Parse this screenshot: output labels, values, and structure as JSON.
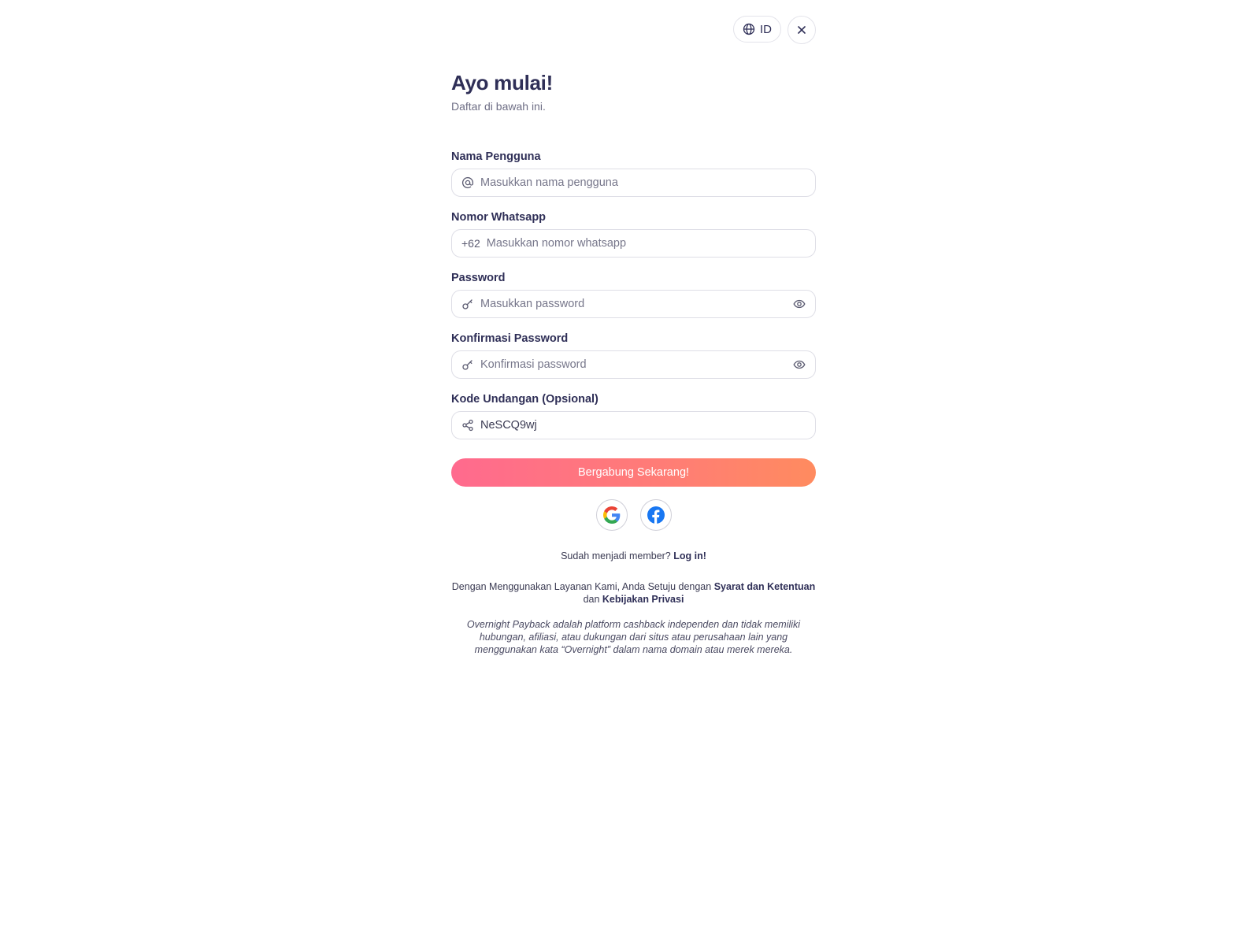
{
  "header": {
    "language_label": "ID",
    "language_icon": "globe-icon",
    "close_icon": "close-icon"
  },
  "intro": {
    "title": "Ayo mulai!",
    "subtitle": "Daftar di bawah ini."
  },
  "form": {
    "username": {
      "label": "Nama Pengguna",
      "placeholder": "Masukkan nama pengguna",
      "value": "",
      "icon": "at-icon"
    },
    "whatsapp": {
      "label": "Nomor Whatsapp",
      "prefix": "+62",
      "placeholder": "Masukkan nomor whatsapp",
      "value": ""
    },
    "password": {
      "label": "Password",
      "placeholder": "Masukkan password",
      "value": "",
      "icon": "key-icon",
      "toggle_icon": "eye-icon"
    },
    "confirm_password": {
      "label": "Konfirmasi Password",
      "placeholder": "Konfirmasi password",
      "value": "",
      "icon": "key-icon",
      "toggle_icon": "eye-icon"
    },
    "invite_code": {
      "label": "Kode Undangan (Opsional)",
      "placeholder": "",
      "value": "NeSCQ9wj",
      "icon": "share-icon"
    },
    "submit_label": "Bergabung Sekarang!"
  },
  "social": {
    "google_icon": "google-icon",
    "facebook_icon": "facebook-icon"
  },
  "login": {
    "text": "Sudah menjadi member?",
    "link_label": "Log in!"
  },
  "terms": {
    "prefix": "Dengan Menggunakan Layanan Kami, Anda Setuju dengan",
    "terms_link": "Syarat dan Ketentuan",
    "connector": "dan",
    "privacy_link": "Kebijakan Privasi"
  },
  "disclaimer": "Overnight Payback adalah platform cashback independen dan tidak memiliki hubungan, afiliasi, atau dukungan dari situs atau perusahaan lain yang menggunakan kata “Overnight” dalam nama domain atau merek mereka.",
  "colors": {
    "primary_text": "#2f2f57",
    "button_gradient_start": "#ff6a8e",
    "button_gradient_end": "#ff8b5f",
    "facebook_blue": "#1877f2"
  }
}
